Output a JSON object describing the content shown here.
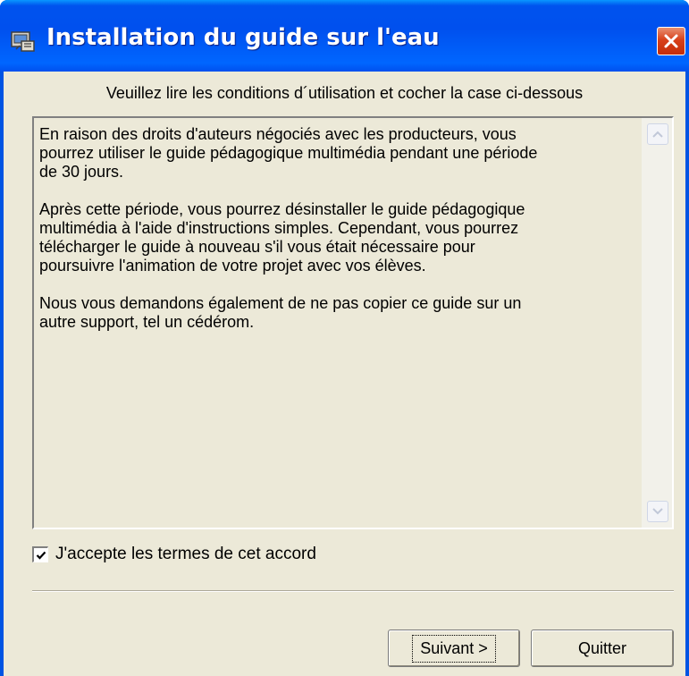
{
  "window": {
    "title": "Installation du guide sur l'eau",
    "title_icon": "installer-icon",
    "close_icon": "close-icon"
  },
  "instruction": "Veuillez lire les conditions d´utilisation et cocher la case ci-dessous",
  "license": {
    "paragraphs": [
      "En raison des droits d'auteurs négociés avec les producteurs, vous pourrez utiliser le guide pédagogique multimédia pendant une période de 30 jours.",
      "Après cette période, vous pourrez désinstaller le guide pédagogique multimédia à l'aide d'instructions simples.  Cependant, vous pourrez télécharger le guide à nouveau s'il vous était  nécessaire pour poursuivre l'animation de votre projet avec vos élèves.",
      "Nous vous demandons également de ne pas copier ce guide sur un autre support, tel un cédérom."
    ]
  },
  "accept": {
    "label": "J'accepte les termes de cet accord",
    "checked": true
  },
  "buttons": {
    "next": "Suivant >",
    "quit": "Quitter"
  },
  "colors": {
    "titlebar": "#0054e3",
    "dialog_bg": "#ece9d8",
    "close_button": "#d8411a"
  }
}
